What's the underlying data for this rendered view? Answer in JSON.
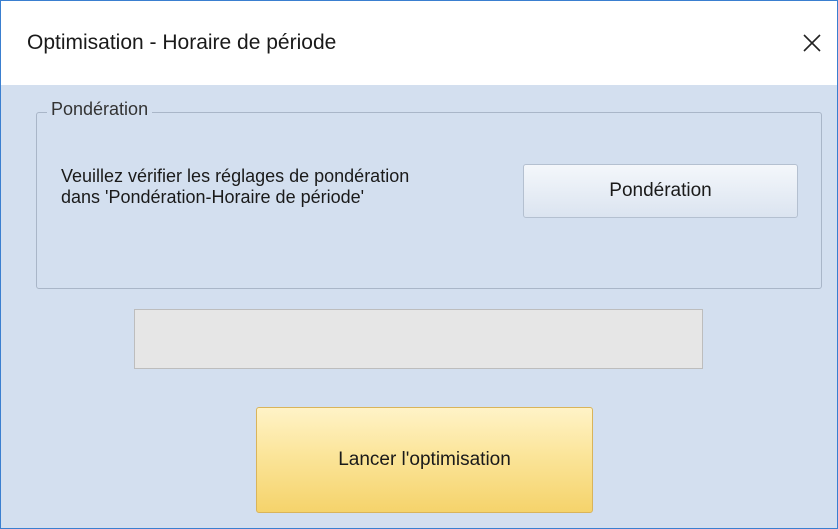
{
  "window": {
    "title": "Optimisation - Horaire de période",
    "close_icon": "close-icon"
  },
  "group": {
    "legend": "Pondération",
    "instruction_line1": "Veuillez vérifier les réglages de pondération",
    "instruction_line2": "dans 'Pondération-Horaire de période'",
    "button_label": "Pondération"
  },
  "progress": {
    "value": 0
  },
  "actions": {
    "launch_label": "Lancer l'optimisation"
  },
  "colors": {
    "window_border": "#3a7fd0",
    "background": "#d3dfef",
    "launch_button": "#f5d36b",
    "progress_fill": "#06b025"
  }
}
